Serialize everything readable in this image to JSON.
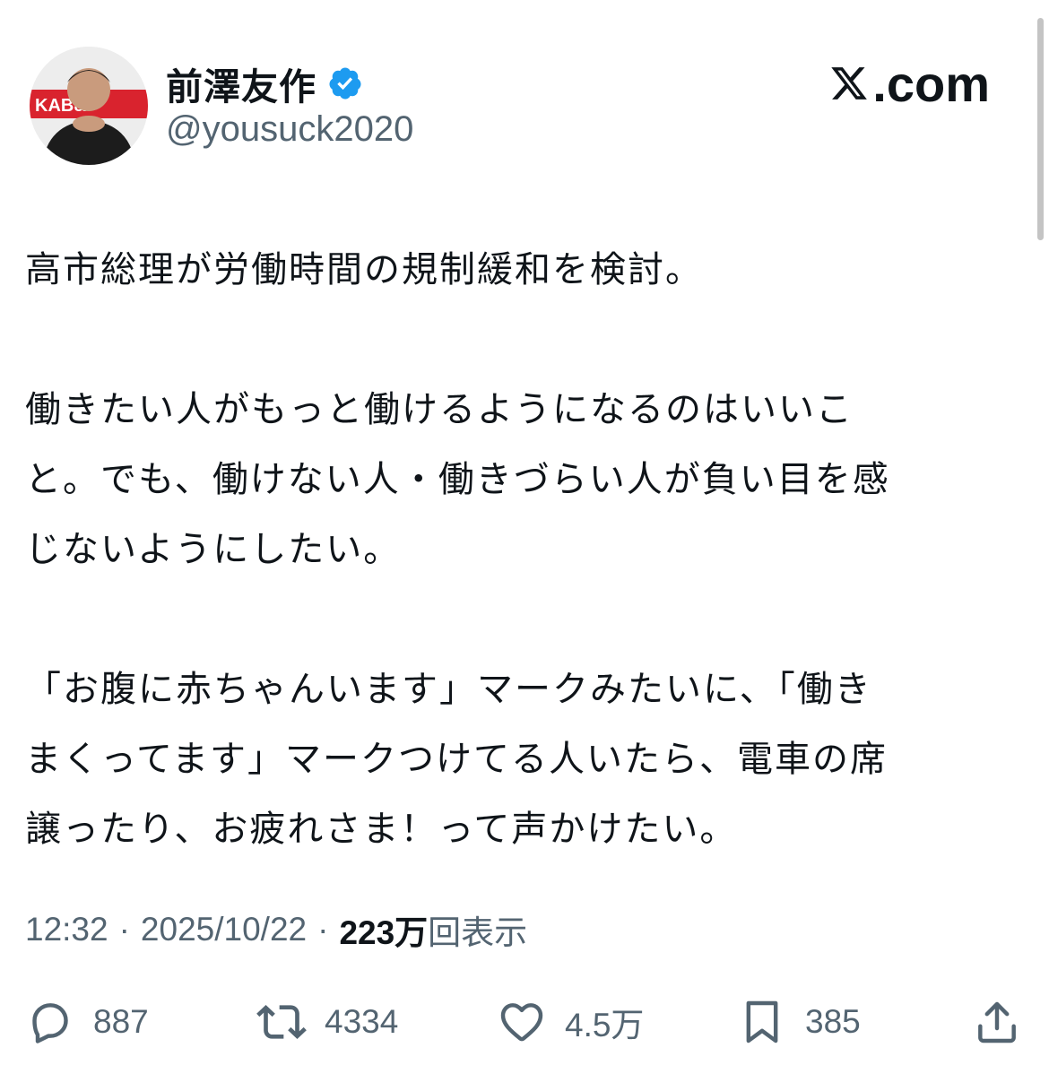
{
  "author": {
    "display_name": "前澤友作",
    "handle": "@yousuck2020",
    "avatar_banner_text": "KAB&"
  },
  "brand": {
    "label": ".com"
  },
  "tweet": {
    "paragraphs": [
      "高市総理が労働時間の規制緩和を検討。",
      "働きたい人がもっと働けるようになるのはいいこ\nと。でも、働けない人・働きづらい人が負い目を感\nじないようにしたい。",
      "「お腹に赤ちゃんいます」マークみたいに、「働き\nまくってます」マークつけてる人いたら、電車の席\n譲ったり、お疲れさま！って声かけたい。"
    ],
    "time": "12:32",
    "date": "2025/10/22",
    "views_count": "223万",
    "views_label": "回表示",
    "separator": "·"
  },
  "actions": {
    "reply_count": "887",
    "retweet_count": "4334",
    "like_count": "4.5万",
    "bookmark_count": "385"
  },
  "colors": {
    "text": "#0f1419",
    "secondary": "#536471",
    "verified": "#1d9bf0"
  },
  "icons": [
    "verified-badge-icon",
    "x-logo-icon",
    "reply-icon",
    "retweet-icon",
    "like-icon",
    "bookmark-icon",
    "share-icon"
  ]
}
